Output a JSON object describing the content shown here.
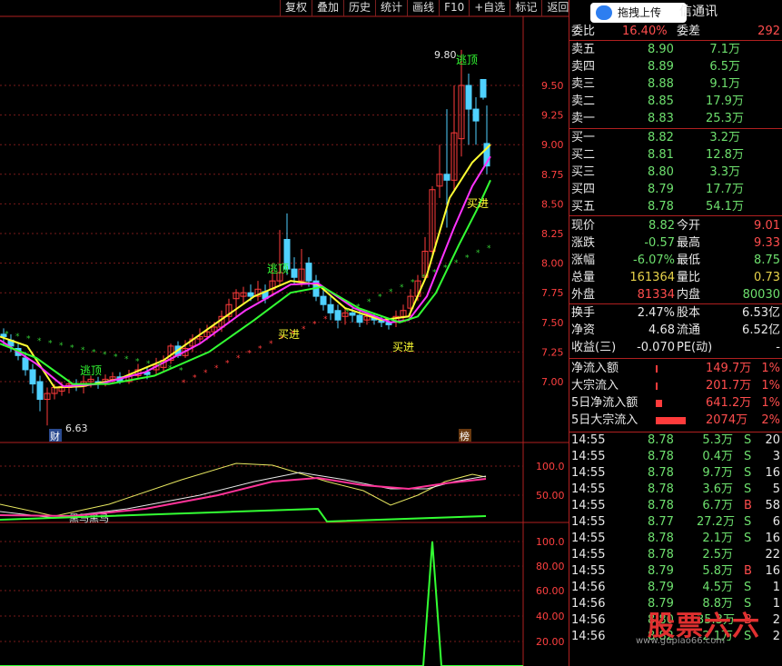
{
  "toolbar": {
    "items": [
      "复权",
      "叠加",
      "历史",
      "统计",
      "画线",
      "F10",
      "+自选",
      "标记",
      "返回"
    ]
  },
  "header": {
    "upload_label": "拖拽上传",
    "brand": "信通讯"
  },
  "chart": {
    "y_ticks": [
      "9.50",
      "9.25",
      "9.00",
      "8.75",
      "8.50",
      "8.25",
      "8.00",
      "7.75",
      "7.50",
      "7.25",
      "7.00"
    ],
    "macd_ticks": [
      "100.0",
      "50.00"
    ],
    "vol_ticks": [
      "100.0",
      "80.00",
      "60.00",
      "40.00",
      "20.00"
    ],
    "annotations": {
      "high_price": "9.80",
      "low_price": "6.63",
      "escape_top": "逃顶",
      "buy_in": "买进",
      "fin_tag": "财",
      "list_tag": "榜",
      "indicator_name": "黑马黑马"
    },
    "colors": {
      "up": "#ff3b3b",
      "down": "#4fd1ff",
      "ma_yellow": "#ffff33",
      "ma_magenta": "#ff33ff",
      "ma_green": "#33ff33"
    }
  },
  "panel": {
    "weibi": {
      "label": "委比",
      "value": "16.40%",
      "label2": "委差",
      "value2": "292"
    },
    "asks": [
      {
        "label": "卖五",
        "price": "8.90",
        "vol": "7.1万"
      },
      {
        "label": "卖四",
        "price": "8.89",
        "vol": "6.5万"
      },
      {
        "label": "卖三",
        "price": "8.88",
        "vol": "9.1万"
      },
      {
        "label": "卖二",
        "price": "8.85",
        "vol": "17.9万"
      },
      {
        "label": "卖一",
        "price": "8.83",
        "vol": "25.3万"
      }
    ],
    "bids": [
      {
        "label": "买一",
        "price": "8.82",
        "vol": "3.2万"
      },
      {
        "label": "买二",
        "price": "8.81",
        "vol": "12.8万"
      },
      {
        "label": "买三",
        "price": "8.80",
        "vol": "3.3万"
      },
      {
        "label": "买四",
        "price": "8.79",
        "vol": "17.7万"
      },
      {
        "label": "买五",
        "price": "8.78",
        "vol": "54.1万"
      }
    ],
    "stats": [
      {
        "l1": "现价",
        "v1": "8.82",
        "c1": "grn",
        "l2": "今开",
        "v2": "9.01",
        "c2": "red"
      },
      {
        "l1": "涨跌",
        "v1": "-0.57",
        "c1": "grn",
        "l2": "最高",
        "v2": "9.33",
        "c2": "red"
      },
      {
        "l1": "涨幅",
        "v1": "-6.07%",
        "c1": "grn",
        "l2": "最低",
        "v2": "8.75",
        "c2": "grn"
      },
      {
        "l1": "总量",
        "v1": "161364",
        "c1": "yel",
        "l2": "量比",
        "v2": "0.73",
        "c2": "yel"
      },
      {
        "l1": "外盘",
        "v1": "81334",
        "c1": "red",
        "l2": "内盘",
        "v2": "80030",
        "c2": "grn"
      }
    ],
    "stats2": [
      {
        "l1": "换手",
        "v1": "2.47%",
        "l2": "股本",
        "v2": "6.53亿"
      },
      {
        "l1": "净资",
        "v1": "4.68",
        "l2": "流通",
        "v2": "6.52亿"
      },
      {
        "l1": "收益(三)",
        "v1": "-0.070",
        "l2": "PE(动)",
        "v2": "-"
      }
    ],
    "flows": [
      {
        "label": "净流入额",
        "value": "149.7万",
        "pct": "1%",
        "bar": 0.02
      },
      {
        "label": "大宗流入",
        "value": "201.7万",
        "pct": "1%",
        "bar": 0.02
      },
      {
        "label": "5日净流入额",
        "value": "641.2万",
        "pct": "1%",
        "bar": 0.12
      },
      {
        "label": "5日大宗流入",
        "value": "2074万",
        "pct": "2%",
        "bar": 0.55
      }
    ],
    "ticks": [
      {
        "t": "14:55",
        "p": "8.78",
        "v": "5.3万",
        "s": "S",
        "n": "20"
      },
      {
        "t": "14:55",
        "p": "8.78",
        "v": "0.4万",
        "s": "S",
        "n": "3"
      },
      {
        "t": "14:55",
        "p": "8.78",
        "v": "9.7万",
        "s": "S",
        "n": "16"
      },
      {
        "t": "14:55",
        "p": "8.78",
        "v": "3.6万",
        "s": "S",
        "n": "5"
      },
      {
        "t": "14:55",
        "p": "8.78",
        "v": "6.7万",
        "s": "B",
        "n": "58"
      },
      {
        "t": "14:55",
        "p": "8.77",
        "v": "27.2万",
        "s": "S",
        "n": "6"
      },
      {
        "t": "14:55",
        "p": "8.78",
        "v": "2.1万",
        "s": "S",
        "n": "16"
      },
      {
        "t": "14:55",
        "p": "8.78",
        "v": "2.5万",
        "s": "",
        "n": "22"
      },
      {
        "t": "14:55",
        "p": "8.79",
        "v": "5.8万",
        "s": "B",
        "n": "16"
      },
      {
        "t": "14:56",
        "p": "8.79",
        "v": "4.5万",
        "s": "S",
        "n": "1"
      },
      {
        "t": "14:56",
        "p": "8.79",
        "v": "8.8万",
        "s": "S",
        "n": "1"
      },
      {
        "t": "14:56",
        "p": "8.80",
        "v": "35.3万",
        "s": "B",
        "n": "2"
      },
      {
        "t": "14:56",
        "p": "8.82",
        "v": "2.1万",
        "s": "S",
        "n": "2"
      }
    ]
  },
  "watermark": {
    "title": "股票六六",
    "url": "www.gupiao66.com"
  }
}
